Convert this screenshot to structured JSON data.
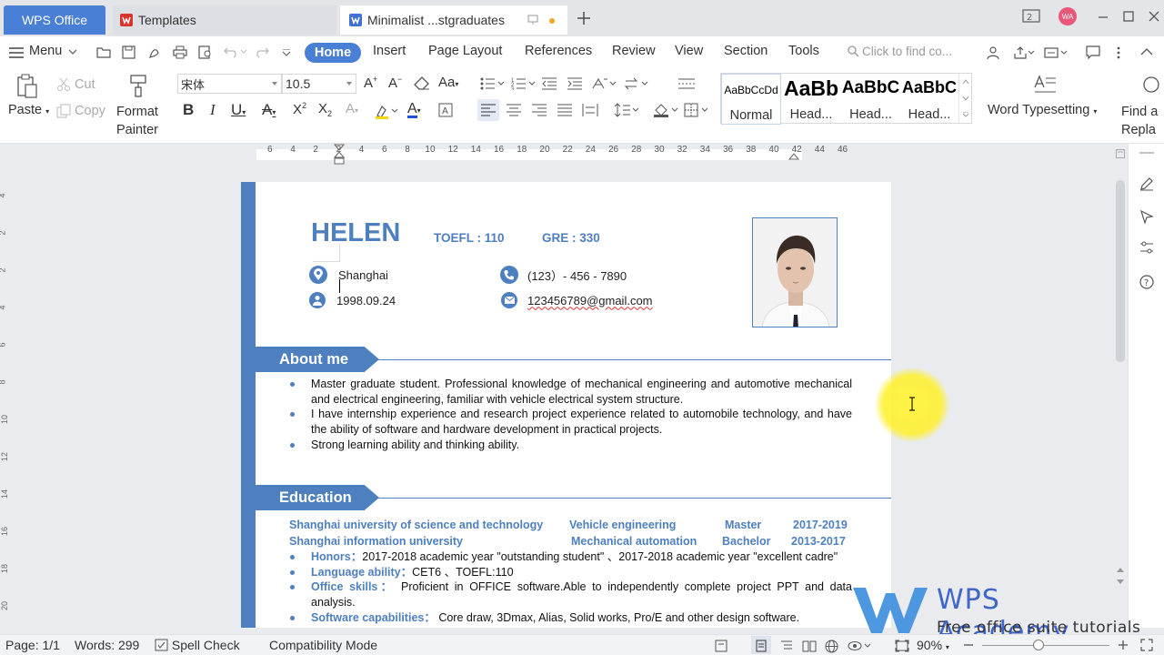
{
  "titlebar": {
    "app_tab": "WPS Office",
    "tabs": [
      {
        "label": "Templates"
      },
      {
        "label": "Minimalist ...stgraduates"
      }
    ],
    "avatar_initials": "WA"
  },
  "menubar": {
    "menu_label": "Menu",
    "tabs": [
      "Home",
      "Insert",
      "Page Layout",
      "References",
      "Review",
      "View",
      "Section",
      "Tools"
    ],
    "search_placeholder": "Click to find co..."
  },
  "ribbon": {
    "paste": "Paste",
    "cut": "Cut",
    "copy": "Copy",
    "format_painter_1": "Format",
    "format_painter_2": "Painter",
    "font_name": "宋体",
    "font_size": "10.5",
    "styles": [
      {
        "preview": "AaBbCcDd",
        "label": "Normal"
      },
      {
        "preview": "AaBb",
        "label": "Head..."
      },
      {
        "preview": "AaBbC",
        "label": "Head..."
      },
      {
        "preview": "AaBbC",
        "label": "Head..."
      }
    ],
    "word_typesetting": "Word Typesetting",
    "find_1": "Find a",
    "find_2": "Repla"
  },
  "ruler": {
    "ticks": [
      "6",
      "4",
      "2",
      "2",
      "4",
      "6",
      "8",
      "10",
      "12",
      "14",
      "16",
      "18",
      "20",
      "22",
      "24",
      "26",
      "28",
      "30",
      "32",
      "34",
      "36",
      "38",
      "40",
      "42",
      "44",
      "46"
    ],
    "vticks": [
      "4",
      "2",
      "2",
      "4",
      "6",
      "8",
      "10",
      "12",
      "14",
      "16",
      "18",
      "20"
    ]
  },
  "document": {
    "name": "HELEN",
    "toefl": "TOEFL : 110",
    "gre": "GRE : 330",
    "city": "Shanghai",
    "phone": "(123）- 456 - 7890",
    "birth": "1998.09.24",
    "email": "123456789@gmail.com",
    "about_title": "About me",
    "about_items": [
      "Master graduate student. Professional knowledge of mechanical engineering and automotive mechanical and electrical engineering, familiar with vehicle electrical system structure.",
      "I have internship experience and research project experience related to automobile technology, and have the ability of software and hardware development in practical projects.",
      "Strong learning ability and thinking ability."
    ],
    "education_title": "Education",
    "edu_rows": [
      {
        "school": "Shanghai university of science and technology",
        "major": "Vehicle engineering",
        "degree": "Master",
        "years": "2017-2019"
      },
      {
        "school": "Shanghai information university",
        "major": "Mechanical automation",
        "degree": "Bachelor",
        "years": "2013-2017"
      }
    ],
    "edu_items": [
      {
        "label": "Honors：",
        "text": "2017-2018 academic year \"outstanding student\" 、2017-2018 academic year \"excellent cadre\""
      },
      {
        "label": "Language ability：",
        "text": "CET6 、TOEFL:110"
      },
      {
        "label": "Office skills：",
        "text": " Proficient in OFFICE software.Able to independently complete project PPT and data analysis."
      },
      {
        "label": "Software capabilities：",
        "text": " Core draw, 3Dmax, Alias, Solid works, Pro/E and other design software."
      }
    ]
  },
  "status": {
    "page": "Page: 1/1",
    "words": "Words: 299",
    "spell_check": "Spell Check",
    "compat": "Compatibility Mode",
    "zoom": "90%"
  },
  "watermark": {
    "title": "WPS Academy",
    "subtitle": "Free office suite tutorials"
  },
  "colors": {
    "accent": "#4a7fd6",
    "resume_blue": "#4e7fbf",
    "cursor_highlight": "#fff23c"
  }
}
